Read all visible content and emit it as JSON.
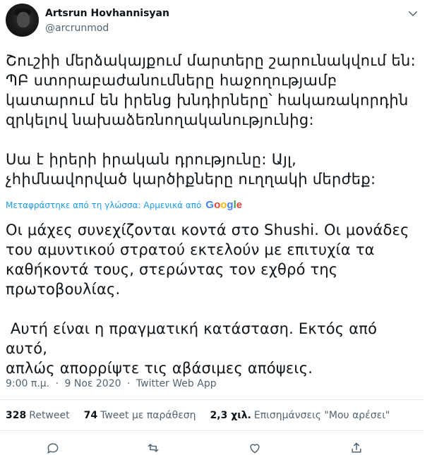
{
  "author": {
    "name": "Artsrun Hovhannisyan",
    "handle": "@arcrunmod"
  },
  "tweet": {
    "original_text": "Շուշիի մերձակայքում մարտերը շարունակվում են:\nՊԲ ստորաբաժանումները հաջողությամբ\nկատարում են իրենց խնդիրները՝ հակառակորդին\nզրկելով նախաձեռնողականությունից:\n\nՍա է իրերի իրական դրությունը: Այլ,\nչհիմնավորված կարծիքները ուղղակի մերժեք:",
    "translation_note": "Μεταφράστηκε από τη γλώσσα: Αρμενικά από",
    "translation_provider": "Google",
    "translated_text": "Οι μάχες συνεχίζονται κοντά στο Shushi. Οι μονάδες\nτου αμυντικού στρατού εκτελούν με επιτυχία τα\nκαθήκοντά τους, στερώντας τον εχθρό της\nπρωτοβουλίας.\n\n Αυτή είναι η πραγματική κατάσταση. Εκτός από αυτό,\nαπλώς απορρίψτε τις αβάσιμες απόψεις.",
    "time": "9:00 π.μ.",
    "date": "9 Νοε 2020",
    "separator": "·",
    "source": "Twitter Web App"
  },
  "stats": {
    "retweets_count": "328",
    "retweets_label": "Retweet",
    "quotes_count": "74",
    "quotes_label": "Tweet με παράθεση",
    "likes_count": "2,3 χιλ.",
    "likes_label": "Επισημάνσεις \"Μου αρέσει\""
  },
  "colors": {
    "link": "#1d9bf0",
    "secondary_text": "#536471",
    "google_blue": "#4285F4",
    "google_red": "#EA4335",
    "google_yellow": "#FBBC05",
    "google_green": "#34A853"
  },
  "icons": [
    "chevron-down-icon",
    "reply-icon",
    "retweet-icon",
    "like-icon",
    "share-icon"
  ]
}
